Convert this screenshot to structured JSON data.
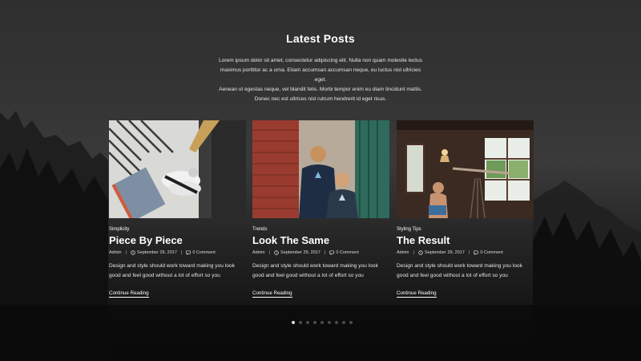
{
  "section": {
    "title": "Latest Posts",
    "intro_lines": [
      "Lorem ipsum dolor sit amet, consectetur adipiscing elit. Nulla non quam molestie lectus",
      "maximus porttitor ac a urna. Etiam accumsan accumsan neque, eu luctus nisl ultricies eget.",
      "Aenean ut egestas neque, vel blandit felis. Morbi tempor enim eu diam tincidunt mattis.",
      "Donec nec est ultrices nisl rutrum hendrerit id eget risus."
    ]
  },
  "posts": [
    {
      "category": "Simplicity",
      "title": "Piece By Piece",
      "author": "Admin",
      "date": "September 29, 2017",
      "comments": "0 Comment",
      "excerpt": "Design and style should work toward making you look good and feel good without a lot of effort so you",
      "more": "Continue Reading"
    },
    {
      "category": "Trends",
      "title": "Look The Same",
      "author": "Admin",
      "date": "September 29, 2017",
      "comments": "0 Comment",
      "excerpt": "Design and style should work toward making you look good and feel good without a lot of effort so you",
      "more": "Continue Reading"
    },
    {
      "category": "Styling Tips",
      "title": "The Result",
      "author": "Admin",
      "date": "September 29, 2017",
      "comments": "0 Comment",
      "excerpt": "Design and style should work toward making you look good and feel good without a lot of effort so you",
      "more": "Continue Reading"
    }
  ],
  "carousel": {
    "total": 9,
    "active": 1
  },
  "icons": {
    "date": "clock-icon",
    "comments": "comment-icon"
  },
  "colors": {
    "text": "#ffffff",
    "dot_active": "#dddddd",
    "dot_inactive": "#4a4a4a"
  }
}
